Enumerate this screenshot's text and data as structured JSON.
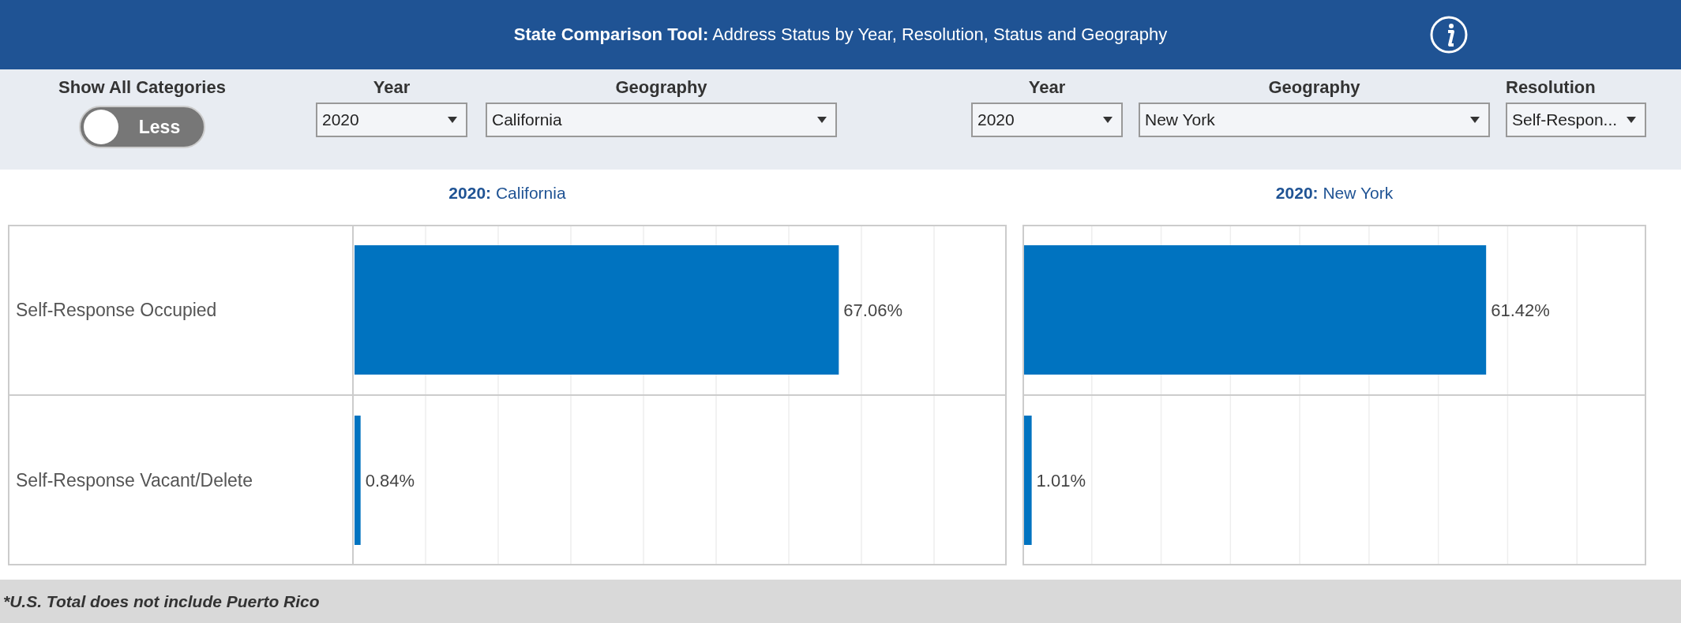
{
  "header": {
    "title": "**State Comparison Tool:** Address Status by Year, Resolution, Status and Geography"
  },
  "toggle": {
    "label": "Show All Categories",
    "state_text": "Less",
    "on": false
  },
  "filters_left": [
    {
      "label": "Year",
      "value": "2020",
      "kind": "short"
    },
    {
      "label": "Geography",
      "value": "California",
      "kind": "wide"
    }
  ],
  "filters_right": [
    {
      "label": "Year",
      "value": "2020",
      "kind": "short"
    },
    {
      "label": "Geography",
      "value": "New York",
      "kind": "wide"
    },
    {
      "label": "Resolution",
      "value": "Self-Respon...",
      "kind": "compact"
    }
  ],
  "charts": [
    {
      "title": "**2020:** California",
      "chart_data": {
        "type": "bar",
        "orientation": "horizontal",
        "categories": [
          "Self-Response Occupied",
          "Self-Response Vacant/Delete"
        ],
        "values": [
          67.06,
          0.84
        ],
        "value_labels": [
          "67.06%",
          "0.84%"
        ]
      }
    },
    {
      "title": "**2020:** New York",
      "chart_data": {
        "type": "bar",
        "orientation": "horizontal",
        "categories": [
          null,
          null
        ],
        "values": [
          61.42,
          1.01
        ],
        "value_labels": [
          "61.42%",
          "1.01%"
        ]
      }
    }
  ],
  "footnote": "*U.S. Total does not include Puerto Rico"
}
